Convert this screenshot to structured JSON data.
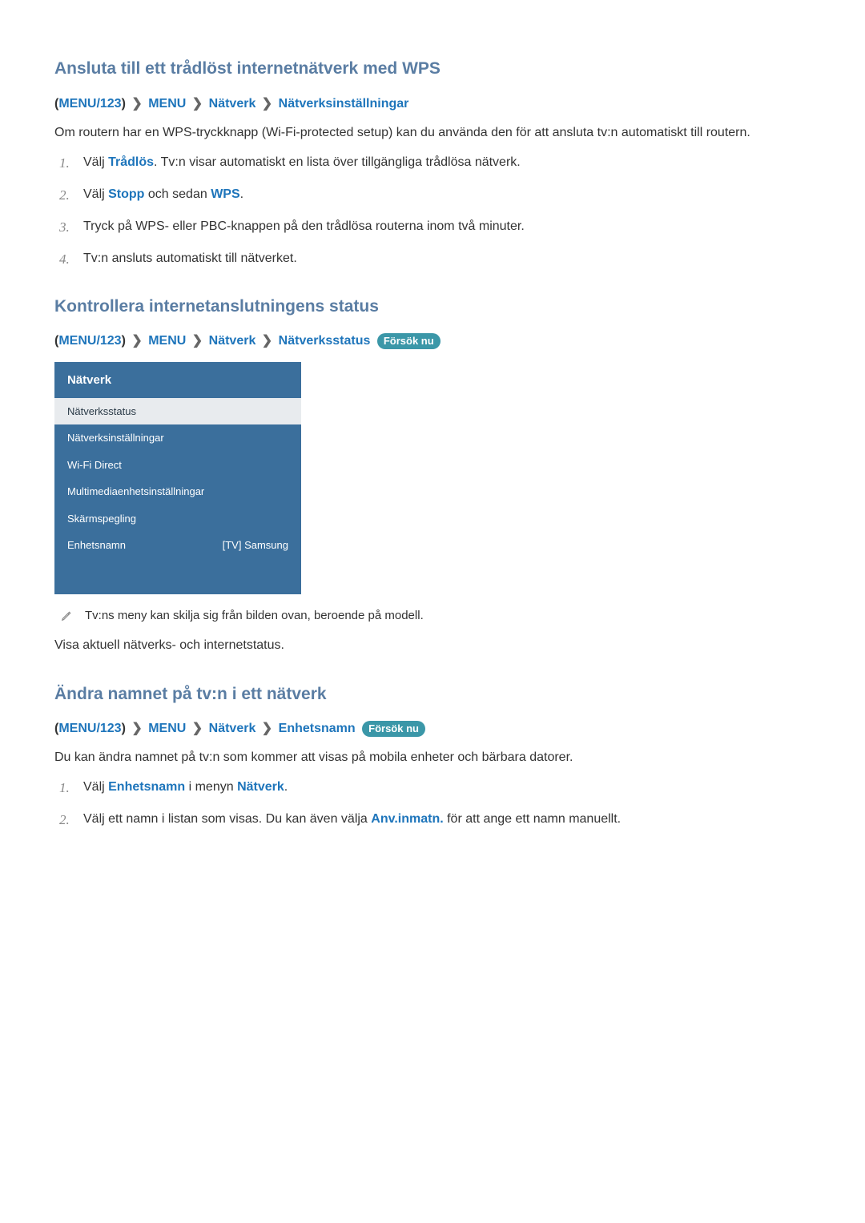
{
  "section1": {
    "heading": "Ansluta till ett trådlöst internetnätverk med WPS",
    "bc": {
      "menu123": "MENU/123",
      "menu": "MENU",
      "natverk": "Nätverk",
      "last": "Nätverksinställningar"
    },
    "intro": "Om routern har en WPS-tryckknapp (Wi-Fi-protected setup) kan du använda den för att ansluta tv:n automatiskt till routern.",
    "steps": {
      "s1_pre": "Välj ",
      "s1_link": "Trådlös",
      "s1_post": ". Tv:n visar automatiskt en lista över tillgängliga trådlösa nätverk.",
      "s2_pre": "Välj ",
      "s2_l1": "Stopp",
      "s2_mid": " och sedan ",
      "s2_l2": "WPS",
      "s2_post": ".",
      "s3": "Tryck på WPS- eller PBC-knappen på den trådlösa routerna inom två minuter.",
      "s4": "Tv:n ansluts automatiskt till nätverket."
    }
  },
  "section2": {
    "heading": "Kontrollera internetanslutningens status",
    "bc": {
      "menu123": "MENU/123",
      "menu": "MENU",
      "natverk": "Nätverk",
      "last": "Nätverksstatus"
    },
    "tryit": "Försök nu",
    "menu": {
      "title": "Nätverk",
      "items": [
        {
          "label": "Nätverksstatus",
          "value": "",
          "selected": true
        },
        {
          "label": "Nätverksinställningar",
          "value": ""
        },
        {
          "label": "Wi-Fi Direct",
          "value": ""
        },
        {
          "label": "Multimediaenhetsinställningar",
          "value": ""
        },
        {
          "label": "Skärmspegling",
          "value": ""
        },
        {
          "label": "Enhetsnamn",
          "value": "[TV] Samsung"
        }
      ]
    },
    "note": "Tv:ns meny kan skilja sig från bilden ovan, beroende på modell.",
    "body": "Visa aktuell nätverks- och internetstatus."
  },
  "section3": {
    "heading": "Ändra namnet på tv:n i ett nätverk",
    "bc": {
      "menu123": "MENU/123",
      "menu": "MENU",
      "natverk": "Nätverk",
      "last": "Enhetsnamn"
    },
    "tryit": "Försök nu",
    "intro": "Du kan ändra namnet på tv:n som kommer att visas på mobila enheter och bärbara datorer.",
    "steps": {
      "s1_pre": "Välj ",
      "s1_l1": "Enhetsnamn",
      "s1_mid": " i menyn ",
      "s1_l2": "Nätverk",
      "s1_post": ".",
      "s2_pre": "Välj ett namn i listan som visas. Du kan även välja ",
      "s2_l1": "Anv.inmatn.",
      "s2_post": " för att ange ett namn manuellt."
    }
  },
  "glyph": {
    "chev": "❯"
  }
}
